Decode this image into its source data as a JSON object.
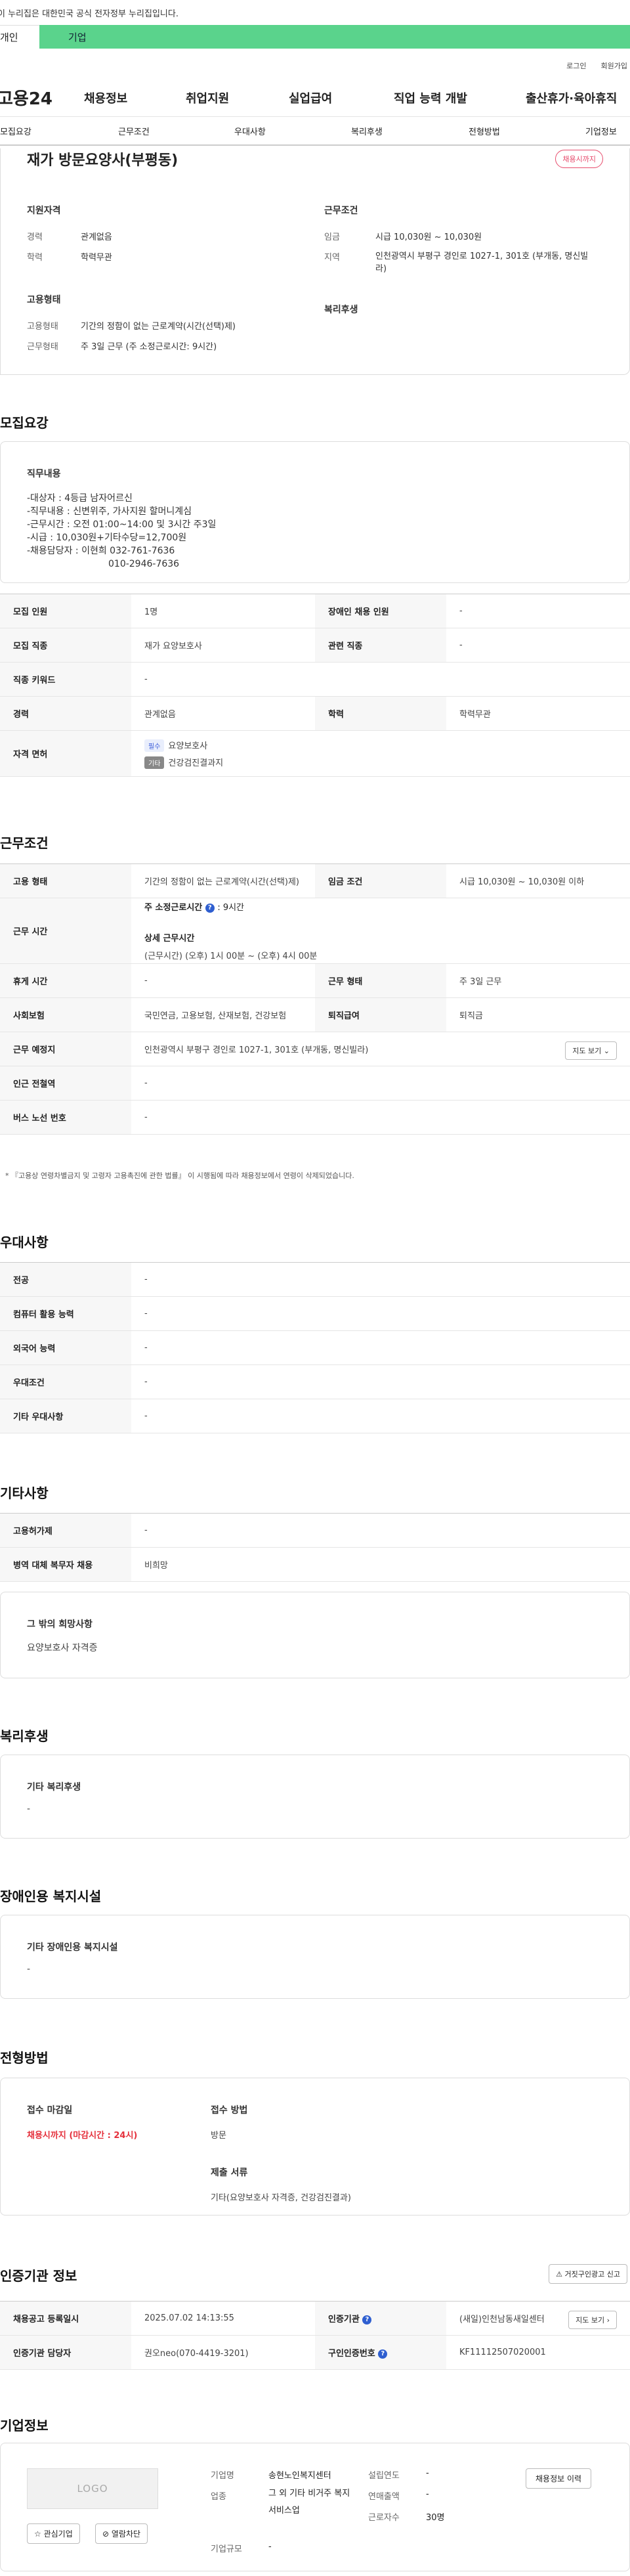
{
  "gov_notice": "이 누리집은 대한민국 공식 전자정부 누리집입니다.",
  "top_tabs": {
    "person": "개인",
    "company": "기업"
  },
  "utility": {
    "login": "로그인",
    "signup": "회원가입"
  },
  "gnb": {
    "logo": "고용24",
    "items": [
      "채용정보",
      "취업지원",
      "실업급여",
      "직업 능력 개발",
      "출산휴가·육아휴직"
    ]
  },
  "subnav": [
    "모집요강",
    "근무조건",
    "우대사항",
    "복리후생",
    "전형방법",
    "기업정보"
  ],
  "summary": {
    "company": "재가 방문요양사(부평동)",
    "deadline_badge": "채용시까지",
    "qualification_title": "지원자격",
    "career_label": "경력",
    "career": "관계없음",
    "education_label": "학력",
    "education": "학력무관",
    "employment_title": "고용형태",
    "employment_type_label": "고용형태",
    "employment_type": "기간의 정함이 없는 근로계약(시간(선택)제)",
    "work_type_label": "근무형태",
    "work_type": "주 3일 근무 (주 소정근로시간: 9시간)",
    "conditions_title": "근무조건",
    "wage_label": "임금",
    "wage": "시급 10,030원 ~ 10,030원",
    "region_label": "지역",
    "region": "인천광역시 부평구 경인로 1027-1, 301호 (부개동, 명신빌라)",
    "welfare_title": "복리후생"
  },
  "recruit": {
    "title": "모집요강",
    "duties_title": "직무내용",
    "duties_lines": [
      "-대상자 : 4등급 남자어르신",
      "-직무내용 : 신변위주, 가사지원 할머니계심",
      "-근무시간 : 오전 01:00~14:00 및 3시간 주3일",
      "-시급 : 10,030원+기타수당=12,700원",
      "-채용담당자 : 이현희 032-761-7636",
      "010-2946-7636"
    ],
    "rows": [
      {
        "k1": "모집 인원",
        "v1": "1명",
        "k2": "장애인 채용 인원",
        "v2": "-"
      },
      {
        "k1": "모집 직종",
        "v1": "재가 요양보호사",
        "k2": "관련 직종",
        "v2": "-"
      },
      {
        "k1": "직종 키워드",
        "v1": "-"
      },
      {
        "k1": "경력",
        "v1": "관계없음",
        "k2": "학력",
        "v2": "학력무관"
      }
    ],
    "license_label": "자격 면허",
    "license_must_tag": "필수",
    "license_must": "요양보호사",
    "license_opt_tag": "기타",
    "license_opt": "건강검진결과지"
  },
  "work": {
    "title": "근무조건",
    "employment_label": "고용 형태",
    "employment": "기간의 정함이 없는 근로계약(시간(선택)제)",
    "wage_label": "임금 조건",
    "wage": "시급 10,030원 ~ 10,030원 이하",
    "hours_label": "근무 시간",
    "hours_weekly_title": "주 소정근로시간",
    "hours_weekly_value": ": 9시간",
    "hours_detail_title": "상세 근무시간",
    "hours_detail": "(근무시간) (오후) 1시 00분 ~ (오후) 4시 00분",
    "rest_label": "휴게 시간",
    "rest": "-",
    "worktype_label": "근무 형태",
    "worktype": "주 3일 근무",
    "insurance_label": "사회보험",
    "insurance": "국민연금, 고용보험, 산재보험, 건강보험",
    "severance_label": "퇴직급여",
    "severance": "퇴직금",
    "place_label": "근무 예정지",
    "place": "인천광역시 부평구 경인로 1027-1, 301호 (부개동, 명신빌라)",
    "map_button": "지도 보기",
    "subway_label": "인근 전철역",
    "subway": "-",
    "bus_label": "버스 노선 번호",
    "bus": "-",
    "note": "* 『고용상 연령차별금지 및 고령자 고용촉진에 관한 법률』 이 시행됨에 따라 채용정보에서 연령이 삭제되었습니다."
  },
  "preference": {
    "title": "우대사항",
    "rows": [
      {
        "k": "전공",
        "v": "-"
      },
      {
        "k": "컴퓨터 활용 능력",
        "v": "-"
      },
      {
        "k": "외국어 능력",
        "v": "-"
      },
      {
        "k": "우대조건",
        "v": "-"
      },
      {
        "k": "기타 우대사항",
        "v": "-"
      }
    ]
  },
  "etc": {
    "title": "기타사항",
    "rows": [
      {
        "k": "고용허가제",
        "v": "-"
      },
      {
        "k": "병역 대체 복무자 채용",
        "v": "비희망"
      }
    ],
    "other_title": "그 밖의 희망사항",
    "other": "요양보호사 자격증"
  },
  "welfare": {
    "title": "복리후생",
    "box_title": "기타 복리후생",
    "box_value": "-"
  },
  "disability": {
    "title": "장애인용 복지시설",
    "box_title": "기타 장애인용 복지시설",
    "box_value": "-"
  },
  "selection": {
    "title": "전형방법",
    "deadline_title": "접수 마감일",
    "deadline": "채용시까지 (마감시간 : 24시)",
    "method_title": "접수 방법",
    "method": "방문",
    "docs_title": "제출 서류",
    "docs": "기타(요양보호사 자격증, 건강검진결과)"
  },
  "cert": {
    "title": "인증기관 정보",
    "report_button": "거짓구인광고 신고",
    "reg_label": "채용공고 등록일시",
    "reg": "2025.07.02 14:13:55",
    "agency_label": "인증기관",
    "agency": "(새일)인천남동새일센터",
    "map_button": "지도 보기",
    "manager_label": "인증기관 담당자",
    "manager": "권오neo(070-4419-3201)",
    "auth_label": "구인인증번호",
    "auth": "KF11112507020001"
  },
  "company": {
    "title": "기업정보",
    "logo": "LOGO",
    "fav_button": "관심기업",
    "block_button": "열람차단",
    "name_label": "기업명",
    "name": "송현노인복지센터",
    "founded_label": "설립연도",
    "founded": "-",
    "industry_label": "업종",
    "industry": "그 외 기타 비거주 복지 서비스업",
    "revenue_label": "연매출액",
    "revenue": "-",
    "employees_label": "근로자수",
    "employees": "30명",
    "size_label": "기업규모",
    "size": "-",
    "history_button": "채용정보 이력"
  }
}
